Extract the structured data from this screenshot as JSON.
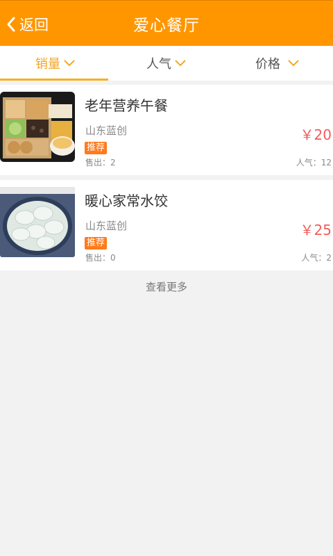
{
  "header": {
    "back_label": "返回",
    "title": "爱心餐厅",
    "bg_color": "#ff9600"
  },
  "tabs": [
    {
      "label": "销量",
      "active": true
    },
    {
      "label": "人气",
      "active": false
    },
    {
      "label": "价格",
      "active": false
    }
  ],
  "items": [
    {
      "name": "老年营养午餐",
      "shop": "山东蓝创",
      "tag": "推荐",
      "sold": "售出：2",
      "price": "￥20",
      "popularity": "人气：12",
      "image": "bento-lunch-photo"
    },
    {
      "name": "暖心家常水饺",
      "shop": "山东蓝创",
      "tag": "推荐",
      "sold": "售出：0",
      "popularity": "人气：2",
      "price": "￥25",
      "image": "dumplings-photo"
    }
  ],
  "more_label": "查看更多",
  "colors": {
    "accent": "#f5a623",
    "price": "#f25c5c",
    "tag": "#ff7a1a"
  }
}
